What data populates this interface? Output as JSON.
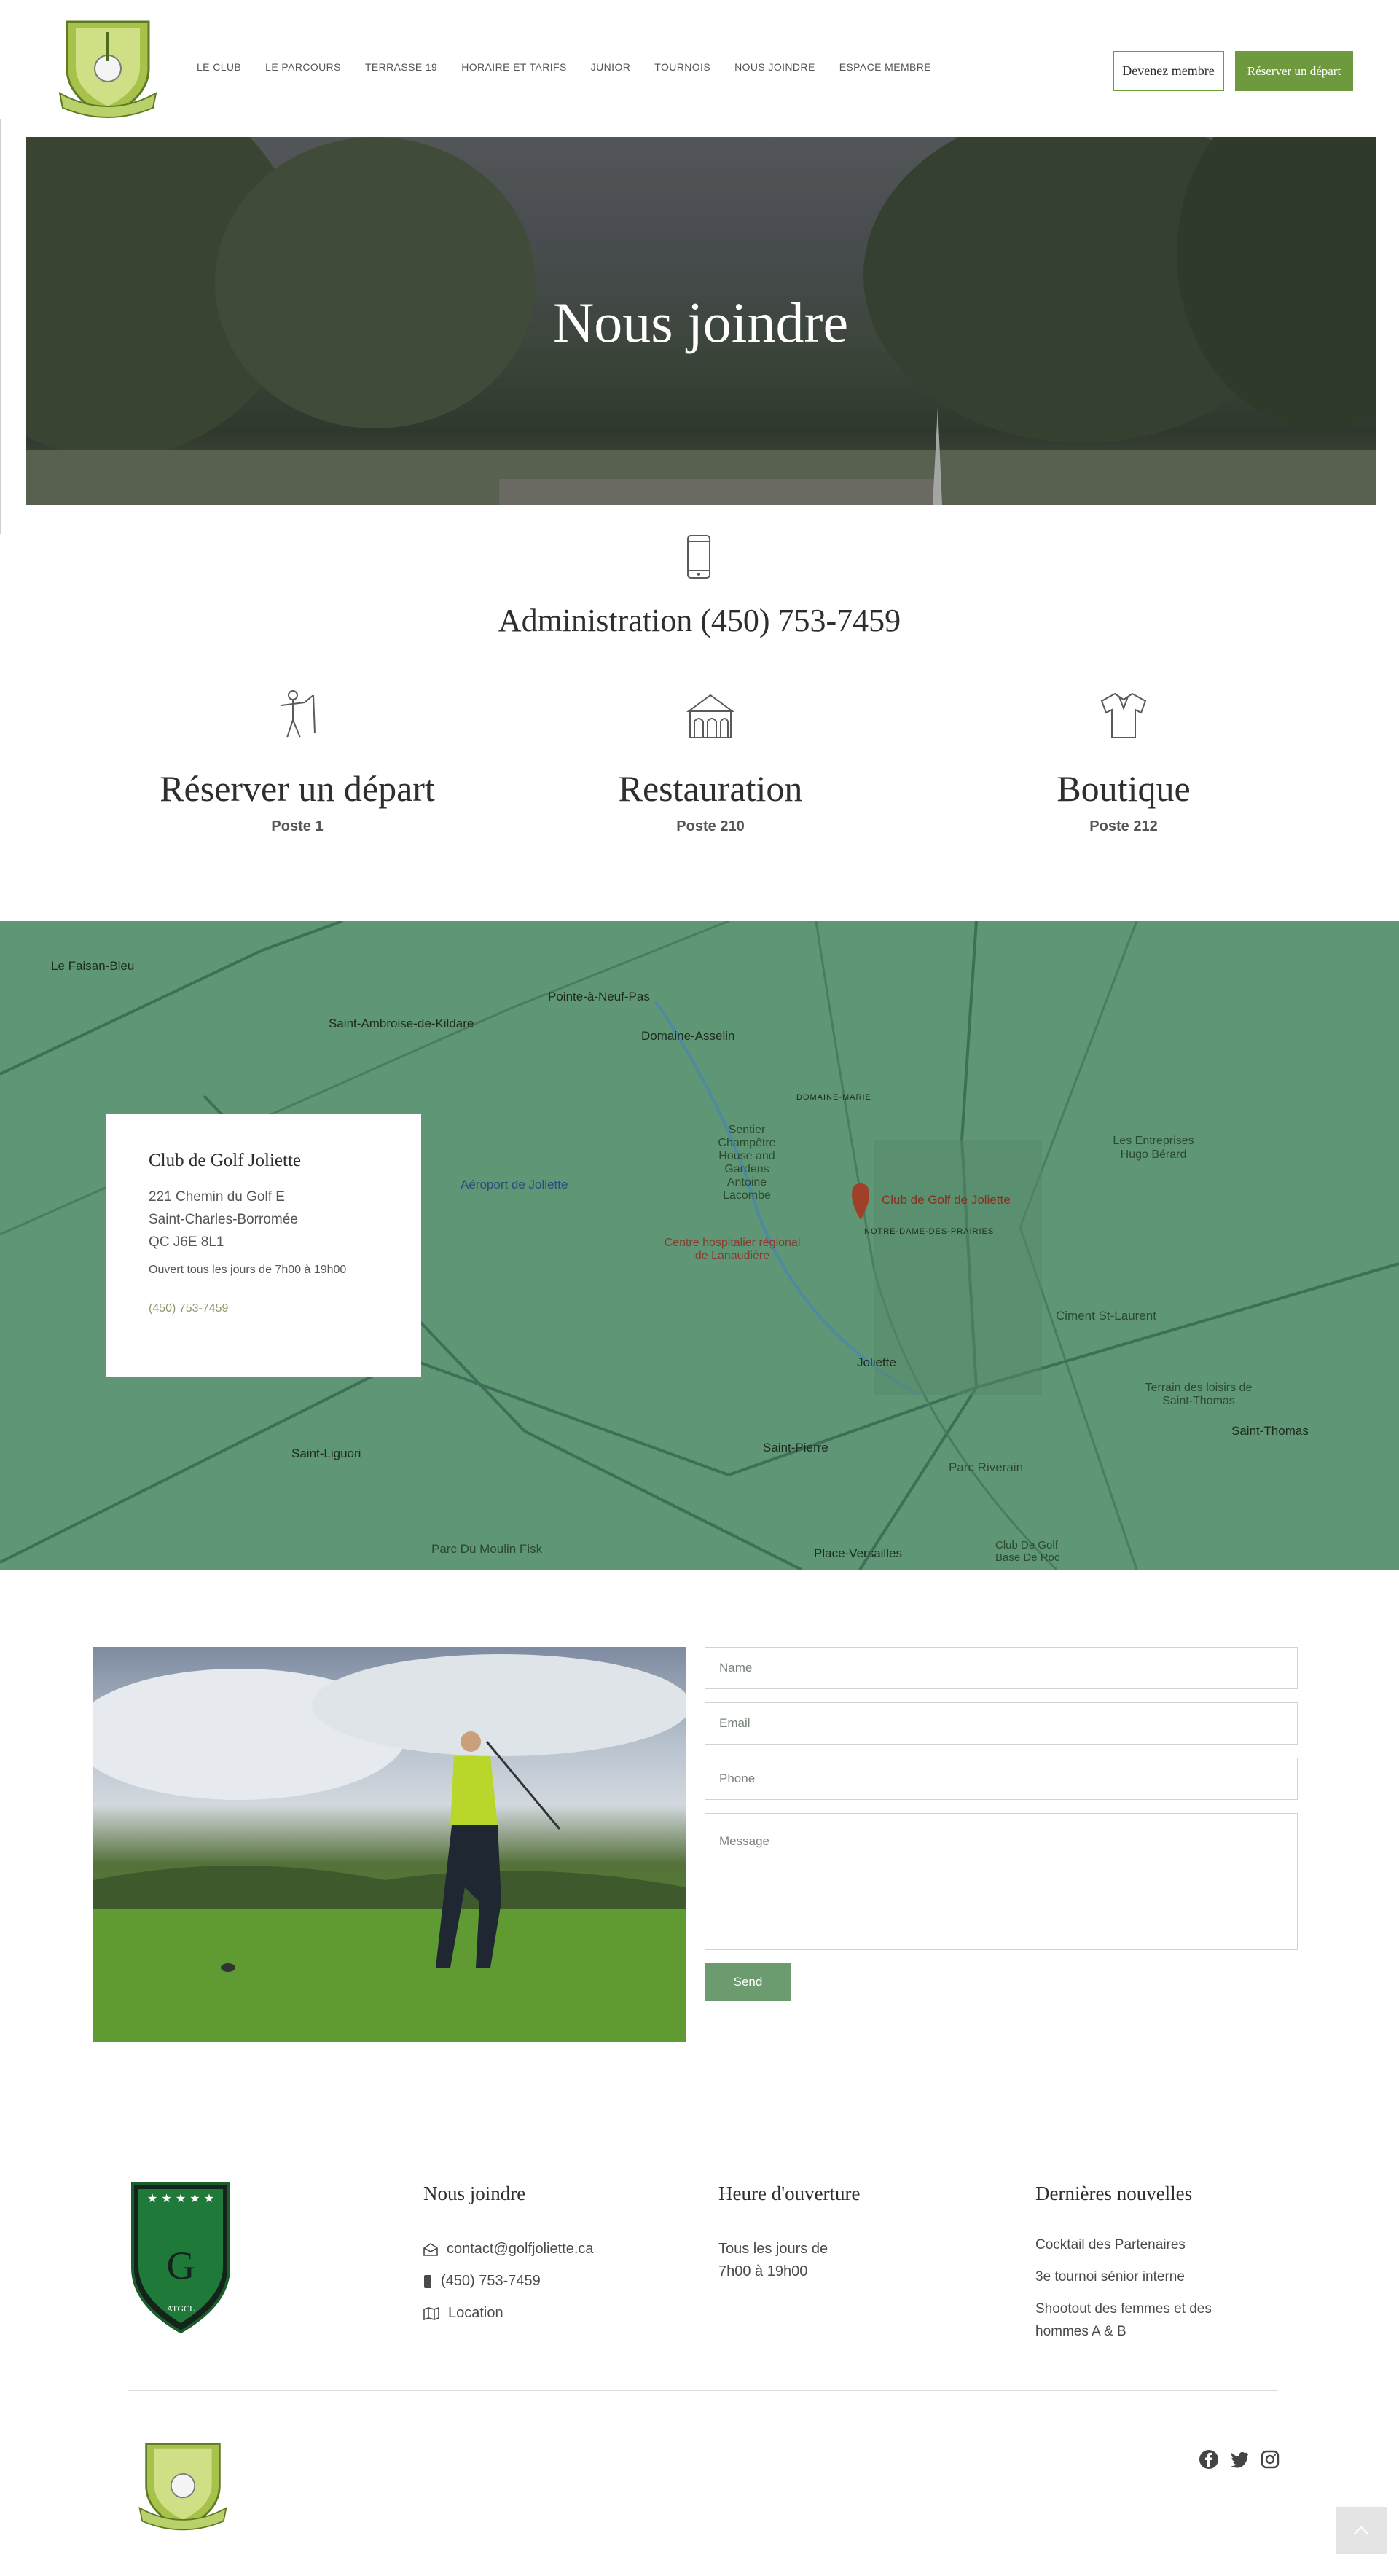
{
  "header": {
    "logo_alt": "Golf Joliette",
    "nav": [
      "LE CLUB",
      "LE PARCOURS",
      "TERRASSE 19",
      "HORAIRE ET TARIFS",
      "JUNIOR",
      "TOURNOIS",
      "NOUS JOINDRE",
      "ESPACE MEMBRE"
    ],
    "member_button": "Devenez membre",
    "book_button": "Réserver un départ"
  },
  "hero": {
    "title": "Nous joindre"
  },
  "contact": {
    "admin": "Administration (450) 753-7459",
    "columns": [
      {
        "title": "Réserver un départ",
        "poste": "Poste 1",
        "icon": "golfer-icon"
      },
      {
        "title": "Restauration",
        "poste": "Poste 210",
        "icon": "clubhouse-icon"
      },
      {
        "title": "Boutique",
        "poste": "Poste 212",
        "icon": "polo-shirt-icon"
      }
    ]
  },
  "map": {
    "card": {
      "name": "Club de Golf Joliette",
      "address_line1": "221 Chemin du Golf E",
      "address_line2": "Saint-Charles-Borromée",
      "address_line3": "QC J6E 8L1",
      "hours": "Ouvert tous les jours de 7h00 à 19h00",
      "phone": "(450) 753-7459"
    },
    "labels": {
      "faisan": "Le Faisan-Bleu",
      "neufpas": "Pointe-à-Neuf-Pas",
      "kildare": "Saint-Ambroise-de-Kildare",
      "assel": "Domaine-Asselin",
      "marie": "DOMAINE-MARIE",
      "sentier": "Sentier Champêtre House and Gardens Antoine Lacombe",
      "aeroport": "Aéroport de Joliette",
      "club": "Club de Golf de Joliette",
      "notredame": "NOTRE-DAME-DES-PRAIRIES",
      "hopital": "Centre hospitalier régional de Lanaudière",
      "entreprises": "Les Entreprises Hugo Bérard",
      "ciment": "Ciment St-Laurent",
      "joliette": "Joliette",
      "loisirs": "Terrain des loisirs de Saint-Thomas",
      "thomas": "Saint-Thomas",
      "liguori": "Saint-Liguori",
      "pierre": "Saint-Pierre",
      "riverain": "Parc Riverain",
      "moulin": "Parc Du Moulin Fisk",
      "versailles": "Place-Versailles",
      "basedroc": "Club De Golf Base De Roc"
    }
  },
  "form": {
    "name": "Name",
    "email": "Email",
    "phone": "Phone",
    "message": "Message",
    "send": "Send"
  },
  "footer": {
    "contact_title": "Nous joindre",
    "email": "contact@golfjoliette.ca",
    "phone": "(450) 753-7459",
    "location": "Location",
    "hours_title": "Heure d'ouverture",
    "hours_line1": "Tous les jours de",
    "hours_line2": "7h00 à 19h00",
    "news_title": "Dernières nouvelles",
    "news": [
      "Cocktail des Partenaires",
      "3e tournoi sénior interne",
      "Shootout des femmes et des hommes A & B"
    ],
    "badge_text": "ATGCL",
    "badge_letter": "G"
  },
  "colors": {
    "accent": "#6c9a3c",
    "map": "#5e9676",
    "send": "#6b9b6f"
  }
}
